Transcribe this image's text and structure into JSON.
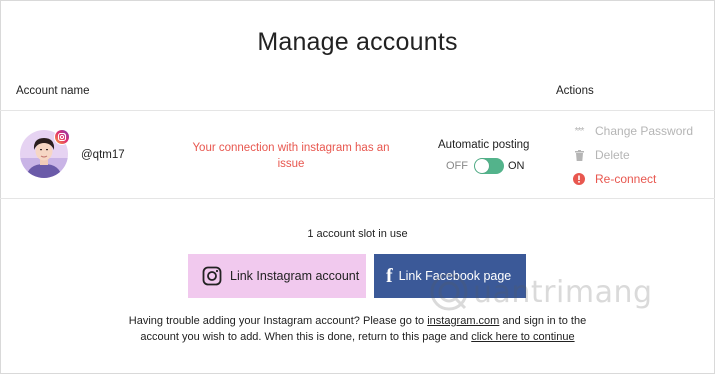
{
  "page": {
    "title": "Manage accounts"
  },
  "table": {
    "col_account": "Account name",
    "col_actions": "Actions"
  },
  "account": {
    "username": "@qtm17",
    "warning_line1": "Your connection with instagram has an",
    "warning_line2": "issue",
    "auto_posting_label": "Automatic posting",
    "toggle_off": "OFF",
    "toggle_on": "ON",
    "auto_posting_enabled": true,
    "actions": {
      "change_password": "Change Password",
      "delete": "Delete",
      "reconnect": "Re-connect"
    }
  },
  "slots": {
    "text": "1 account slot in use"
  },
  "buttons": {
    "instagram": "Link Instagram account",
    "facebook": "Link Facebook page"
  },
  "help": {
    "part1": "Having trouble adding your Instagram account? Please go to",
    "link1": "instagram.com",
    "part2": "and sign in to the account you wish to add. When this is done, return to this page and",
    "link2": "click here to continue"
  },
  "watermark": {
    "text": "uantrimang"
  },
  "colors": {
    "warning": "#e8574f",
    "toggle_on": "#53b38b",
    "instagram_button": "#f1c9ee",
    "facebook_button": "#3b5998",
    "action_muted": "#b5b5b5"
  },
  "icons": {
    "instagram": "instagram-icon",
    "facebook": "facebook-icon",
    "password": "asterisks-icon",
    "delete": "trash-icon",
    "reconnect": "alert-circle-icon"
  }
}
